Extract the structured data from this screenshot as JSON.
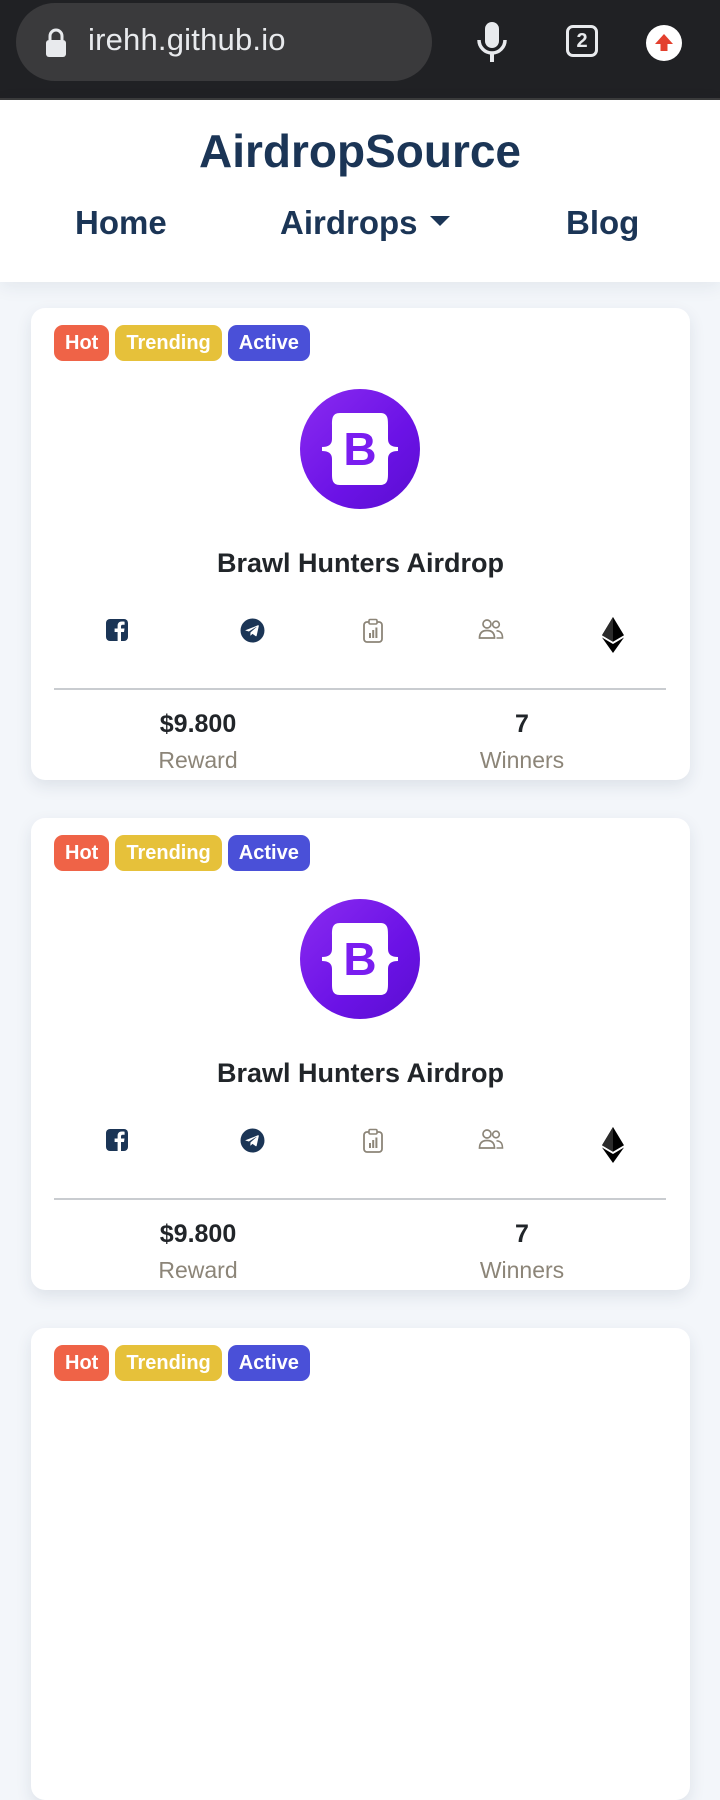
{
  "browser": {
    "url": "irehh.github.io",
    "tab_count": "2"
  },
  "site": {
    "brand": "AirdropSource",
    "nav": {
      "home": "Home",
      "airdrops": "Airdrops",
      "blog": "Blog"
    }
  },
  "cards": [
    {
      "badges": {
        "hot": "Hot",
        "trending": "Trending",
        "active": "Active"
      },
      "logo_letter": "B",
      "title": "Brawl Hunters Airdrop",
      "reward_value": "$9.800",
      "reward_label": "Reward",
      "winners_value": "7",
      "winners_label": "Winners"
    },
    {
      "badges": {
        "hot": "Hot",
        "trending": "Trending",
        "active": "Active"
      },
      "logo_letter": "B",
      "title": "Brawl Hunters Airdrop",
      "reward_value": "$9.800",
      "reward_label": "Reward",
      "winners_value": "7",
      "winners_label": "Winners"
    },
    {
      "badges": {
        "hot": "Hot",
        "trending": "Trending",
        "active": "Active"
      }
    }
  ],
  "icons": [
    "facebook-icon",
    "telegram-icon",
    "clipboard-chart-icon",
    "people-icon",
    "ethereum-icon"
  ],
  "colors": {
    "brand_text": "#1b3556",
    "hot": "#ef6347",
    "trending": "#e6c13a",
    "active": "#4a50d8",
    "logo_purple": "#7a1df0"
  }
}
